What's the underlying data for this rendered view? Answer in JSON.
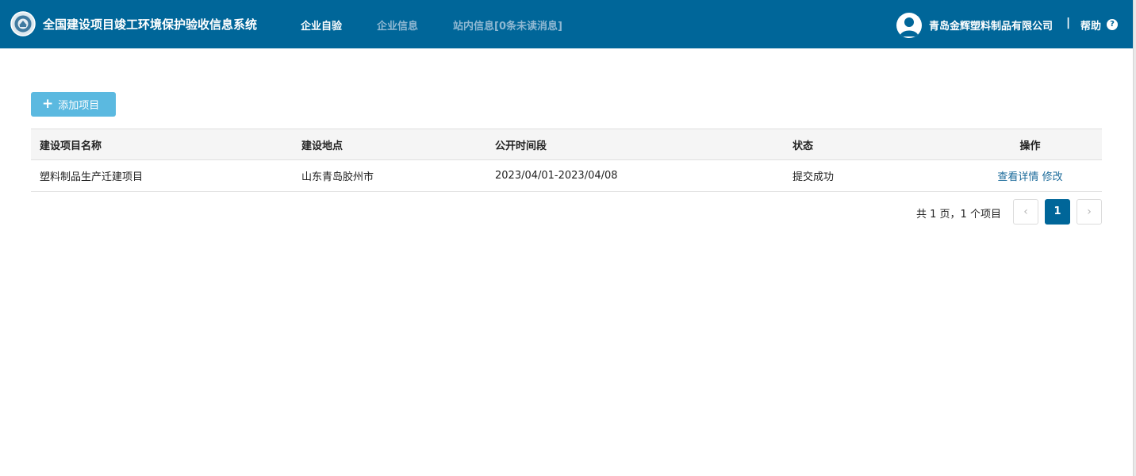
{
  "header": {
    "title": "全国建设项目竣工环境保护验收信息系统",
    "nav": [
      {
        "label": "企业自验",
        "active": true
      },
      {
        "label": "企业信息",
        "active": false
      },
      {
        "label": "站内信息[0条未读消息]",
        "active": false
      }
    ],
    "company": "青岛金辉塑料制品有限公司",
    "separator": "|",
    "help_label": "帮助",
    "help_icon": "?",
    "bg_color": "#006699"
  },
  "toolbar": {
    "add_icon": "+",
    "add_label": "添加项目"
  },
  "table": {
    "columns": [
      "建设项目名称",
      "建设地点",
      "公开时间段",
      "状态",
      "操作"
    ],
    "rows": [
      {
        "name": "塑料制品生产迁建项目",
        "location": "山东青岛胶州市",
        "period": "2023/04/01-2023/04/08",
        "status": "提交成功",
        "actions": [
          "查看详情",
          "修改"
        ]
      }
    ]
  },
  "pagination": {
    "summary": "共 1 页，1 个项目",
    "prev": "‹",
    "current": "1",
    "next": "›"
  }
}
